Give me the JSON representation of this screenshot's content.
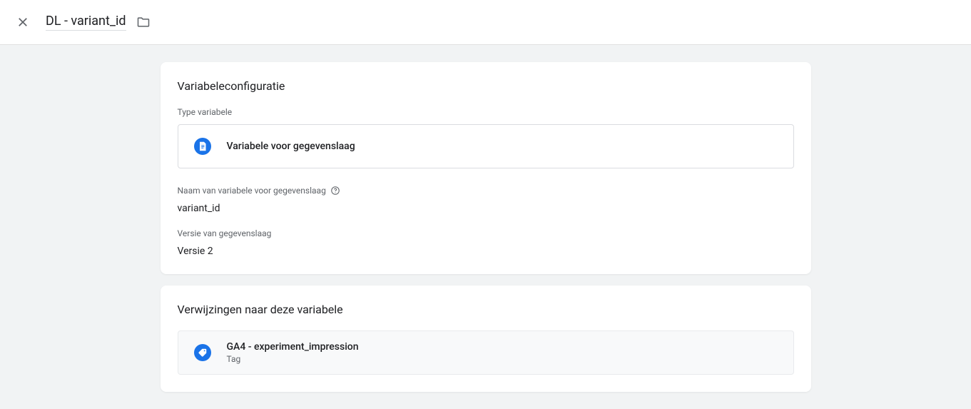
{
  "header": {
    "title": "DL - variant_id"
  },
  "config": {
    "card_title": "Variabeleconfiguratie",
    "type_label": "Type variabele",
    "type_value": "Variabele voor gegevenslaag",
    "name_label": "Naam van variabele voor gegevenslaag",
    "name_value": "variant_id",
    "version_label": "Versie van gegevenslaag",
    "version_value": "Versie 2"
  },
  "references": {
    "card_title": "Verwijzingen naar deze variabele",
    "items": [
      {
        "name": "GA4 - experiment_impression",
        "type": "Tag"
      }
    ]
  }
}
